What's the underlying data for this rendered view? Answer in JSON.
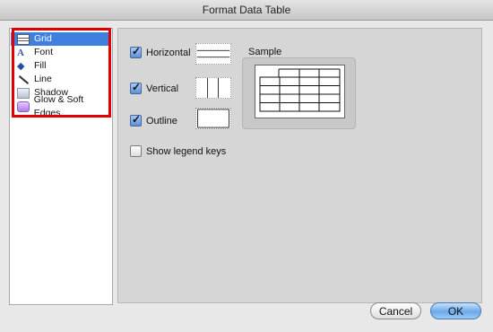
{
  "window": {
    "title": "Format Data Table"
  },
  "sidebar": {
    "items": [
      {
        "label": "Grid",
        "icon": "grid-icon",
        "selected": true
      },
      {
        "label": "Font",
        "icon": "font-icon",
        "selected": false
      },
      {
        "label": "Fill",
        "icon": "fill-icon",
        "selected": false
      },
      {
        "label": "Line",
        "icon": "line-icon",
        "selected": false
      },
      {
        "label": "Shadow",
        "icon": "shadow-icon",
        "selected": false
      },
      {
        "label": "Glow & Soft Edges",
        "icon": "glow-icon",
        "selected": false
      }
    ]
  },
  "grid": {
    "horizontal": {
      "label": "Horizontal",
      "checked": true
    },
    "vertical": {
      "label": "Vertical",
      "checked": true
    },
    "outline": {
      "label": "Outline",
      "checked": true
    },
    "legend": {
      "label": "Show legend keys",
      "checked": false
    }
  },
  "sample": {
    "label": "Sample"
  },
  "buttons": {
    "cancel": "Cancel",
    "ok": "OK"
  },
  "colors": {
    "selection": "#3f7fe0",
    "highlight": "#e10000",
    "ok_button": "#6aa9ea"
  }
}
